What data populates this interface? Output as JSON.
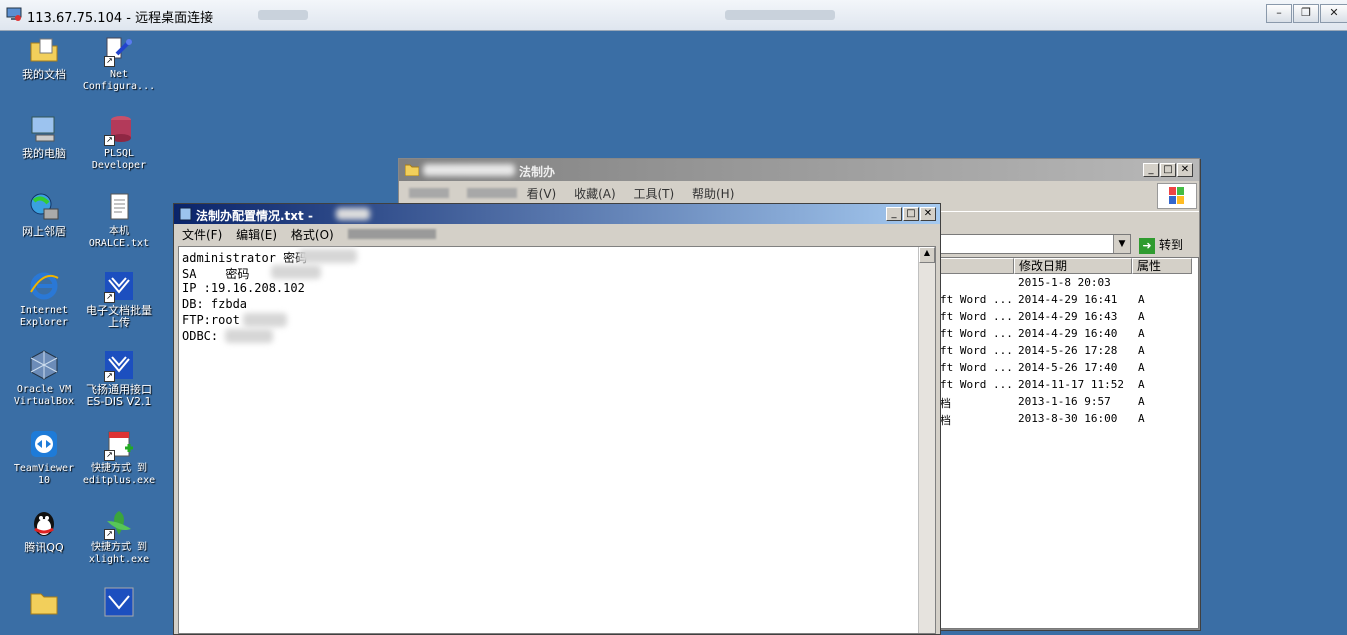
{
  "rdp": {
    "title": "113.67.75.104 - 远程桌面连接"
  },
  "desktop_icons": [
    {
      "label": "我的文档",
      "icon": "folder-docs-icon"
    },
    {
      "label": "Net\nConfigura...",
      "icon": "net-config-icon"
    },
    {
      "label": "我的电脑",
      "icon": "computer-icon"
    },
    {
      "label": "PLSQL\nDeveloper",
      "icon": "database-icon"
    },
    {
      "label": "网上邻居",
      "icon": "network-icon"
    },
    {
      "label": "本机\nORALCE.txt",
      "icon": "text-file-icon"
    },
    {
      "label": "Internet\nExplorer",
      "icon": "ie-icon"
    },
    {
      "label": "电子文档批量\n上传",
      "icon": "upload-app-icon"
    },
    {
      "label": "Oracle VM\nVirtualBox",
      "icon": "virtualbox-icon"
    },
    {
      "label": "飞扬通用接口\nES-DIS V2.1",
      "icon": "interface-app-icon"
    },
    {
      "label": "TeamViewer\n10",
      "icon": "teamviewer-icon"
    },
    {
      "label": "快捷方式 到\neditplus.exe",
      "icon": "editplus-icon"
    },
    {
      "label": "腾讯QQ",
      "icon": "qq-icon"
    },
    {
      "label": "快捷方式 到\nxlight.exe",
      "icon": "xlight-icon"
    }
  ],
  "explorer": {
    "title": "法制办",
    "menu": [
      "看(V)",
      "收藏(A)",
      "工具(T)",
      "帮助(H)"
    ],
    "goto_label": "转到",
    "columns": [
      "修改日期",
      "属性"
    ],
    "rows": [
      {
        "type": "",
        "date": "2015-1-8 20:03",
        "attr": ""
      },
      {
        "type": "ft Word ...",
        "date": "2014-4-29 16:41",
        "attr": "A"
      },
      {
        "type": "ft Word ...",
        "date": "2014-4-29 16:43",
        "attr": "A"
      },
      {
        "type": "ft Word ...",
        "date": "2014-4-29 16:40",
        "attr": "A"
      },
      {
        "type": "ft Word ...",
        "date": "2014-5-26 17:28",
        "attr": "A"
      },
      {
        "type": "ft Word ...",
        "date": "2014-5-26 17:40",
        "attr": "A"
      },
      {
        "type": "ft Word ...",
        "date": "2014-11-17 11:52",
        "attr": "A"
      },
      {
        "type": "档",
        "date": "2013-1-16 9:57",
        "attr": "A"
      },
      {
        "type": "档",
        "date": "2013-8-30 16:00",
        "attr": "A"
      }
    ]
  },
  "notepad": {
    "title": "法制办配置情况.txt -",
    "menu": [
      "文件(F)",
      "编辑(E)",
      "格式(O)"
    ],
    "lines": [
      "administrator 密码",
      "SA    密码",
      "IP :19.16.208.102",
      "DB: fzbda",
      "FTP:root",
      "ODBC:"
    ]
  }
}
